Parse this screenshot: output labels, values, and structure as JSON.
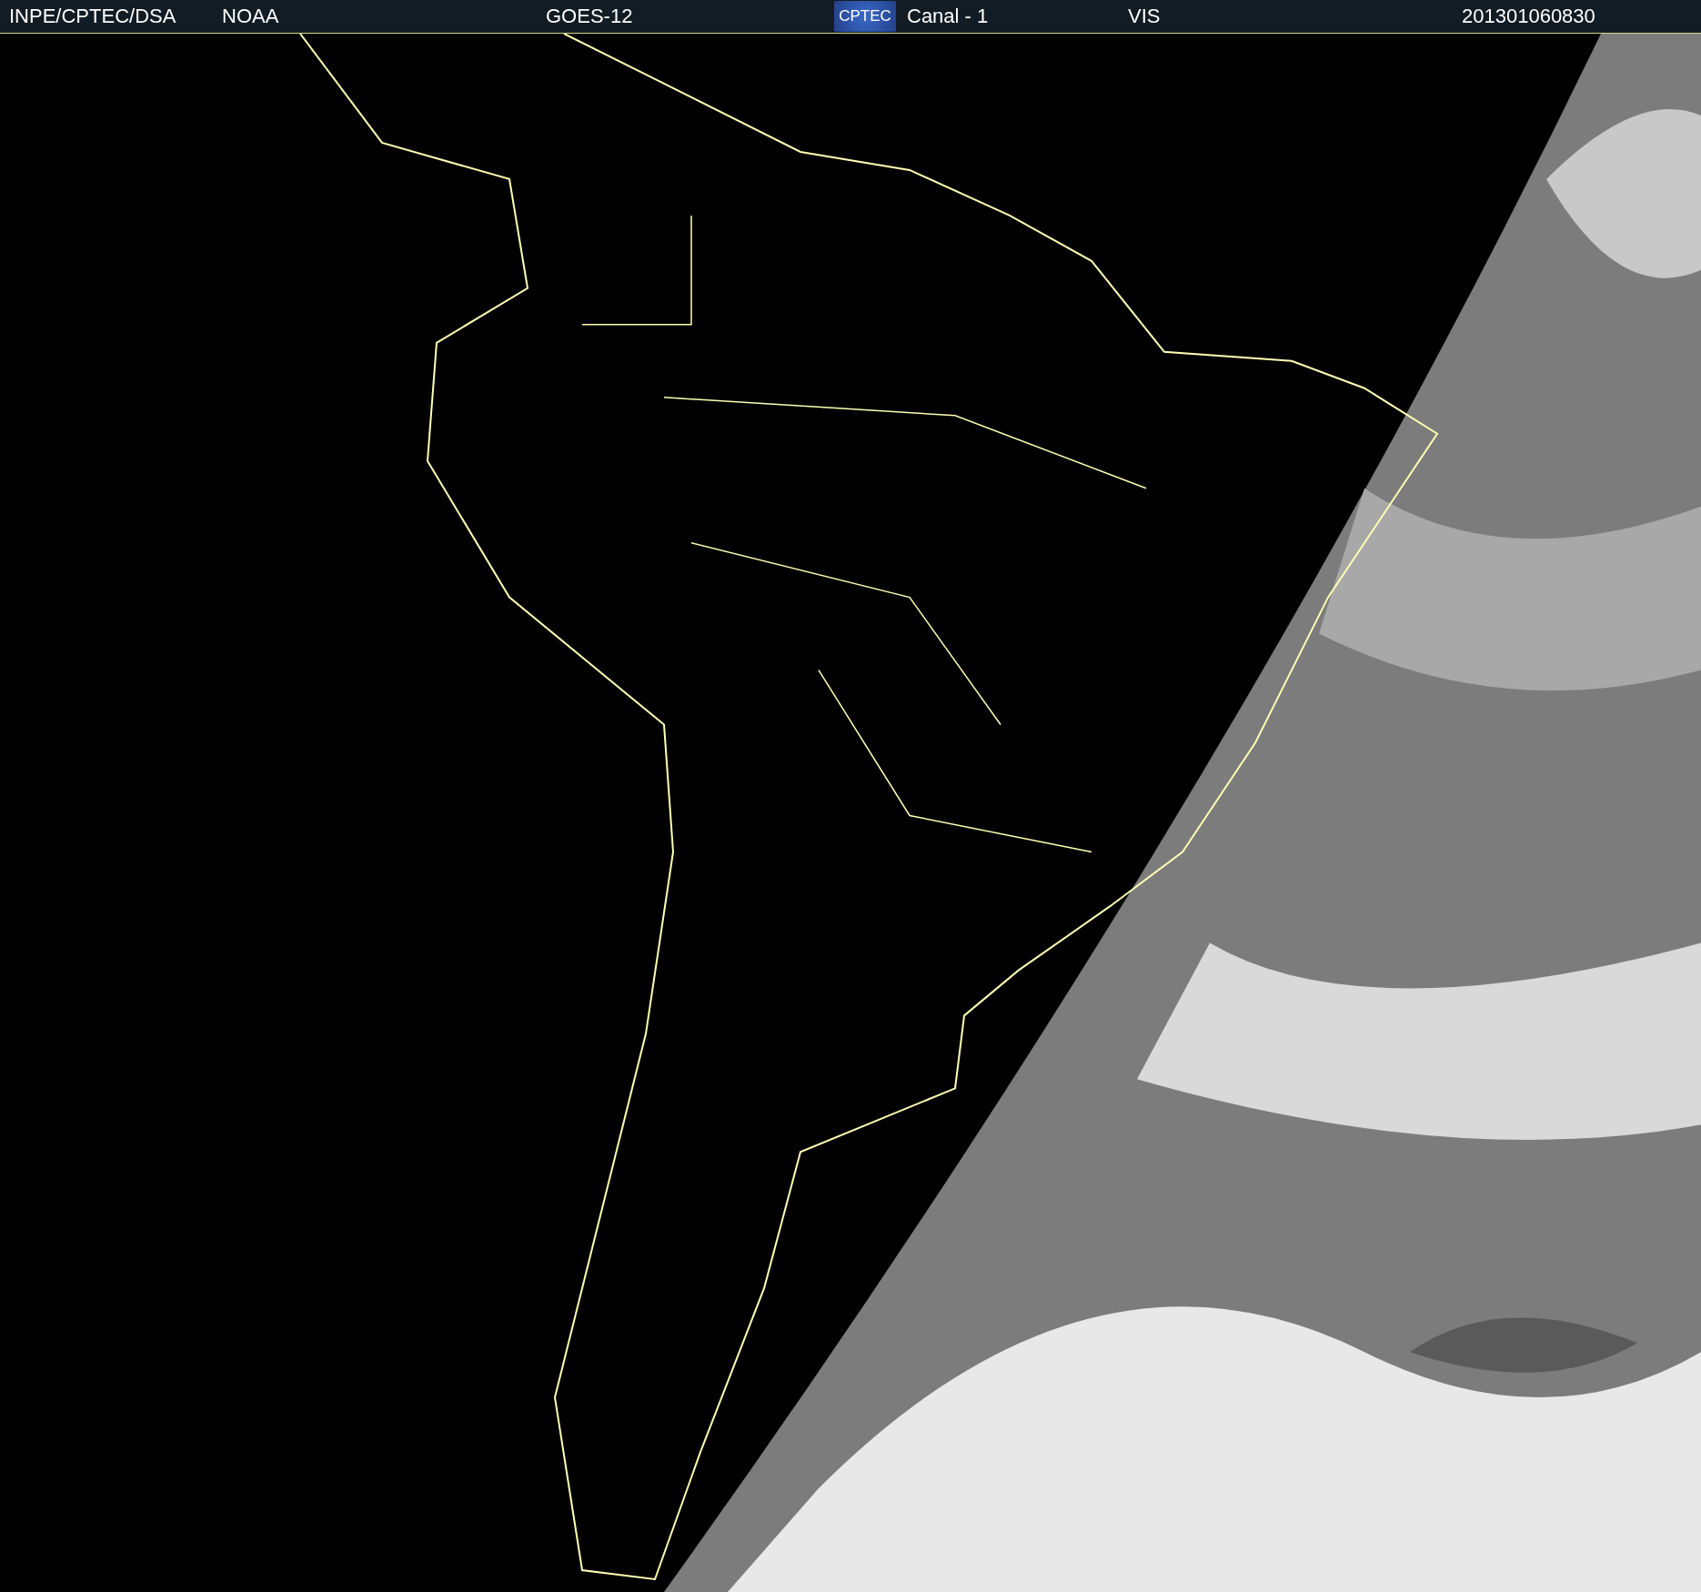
{
  "header": {
    "items": [
      {
        "kind": "text",
        "text": "INPE/CPTEC/DSA"
      },
      {
        "kind": "text",
        "text": "NOAA"
      },
      {
        "kind": "text",
        "text": "GOES-12"
      },
      {
        "kind": "logo",
        "text": "CPTEC"
      },
      {
        "kind": "text",
        "text": "Canal - 1"
      },
      {
        "kind": "text",
        "text": "VIS"
      },
      {
        "kind": "text",
        "text": "201301060830"
      }
    ]
  }
}
